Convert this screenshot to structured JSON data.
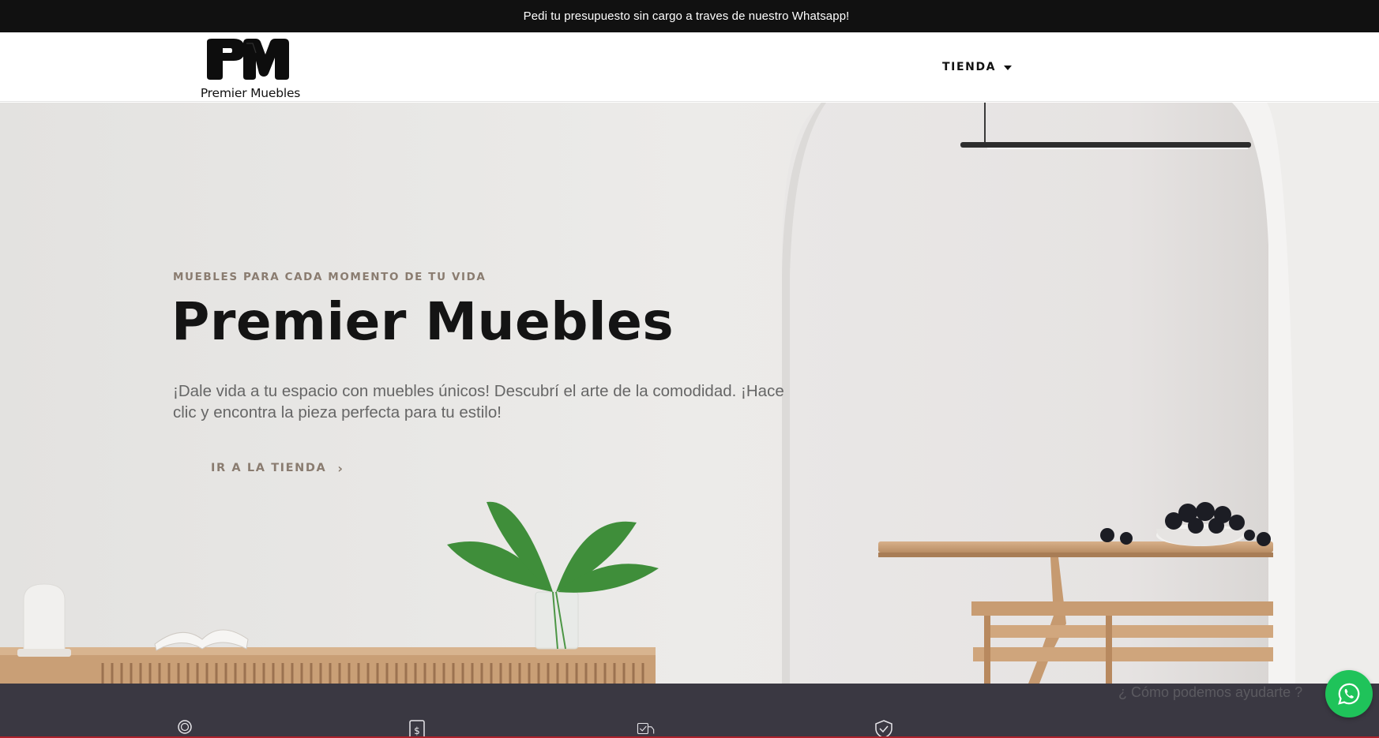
{
  "announcement": {
    "text": "Pedi tu presupuesto sin cargo a traves de nuestro Whatsapp!"
  },
  "header": {
    "logo_text": "Premier Muebles",
    "nav": [
      {
        "label": "TIENDA",
        "has_dropdown": true
      }
    ]
  },
  "hero": {
    "eyebrow": "MUEBLES PARA CADA MOMENTO DE TU VIDA",
    "title": "Premier Muebles",
    "description": "¡Dale vida a tu espacio con muebles únicos! Descubrí el arte de la comodidad. ¡Hace clic y encontra la pieza perfecta para tu estilo!",
    "cta_label": "IR A LA TIENDA"
  },
  "features": {
    "icons": [
      "award-icon",
      "price-tag-icon",
      "delivery-icon",
      "shield-check-icon"
    ]
  },
  "chat": {
    "prompt": "¿ Cómo podemos ayudarte ?",
    "button_icon": "whatsapp-icon"
  },
  "colors": {
    "topbar_bg": "#111111",
    "accent_text": "#8a7c70",
    "features_bg": "#3a3842",
    "whatsapp_green": "#1fc35a"
  }
}
